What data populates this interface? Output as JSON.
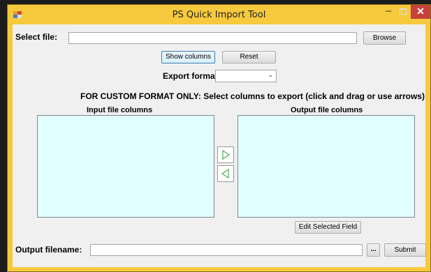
{
  "window": {
    "title": "PS Quick Import Tool"
  },
  "controls": {
    "minimize": "–",
    "close": "✕"
  },
  "select_file": {
    "label": "Select file:",
    "value": "",
    "browse_label": "Browse"
  },
  "show_columns_label": "Show columns",
  "reset_label": "Reset",
  "export_format": {
    "label": "Export format:",
    "selected": ""
  },
  "custom_note": "FOR CUSTOM FORMAT ONLY: Select columns to export (click and drag or use arrows)",
  "input_columns": {
    "label": "Input file columns",
    "items": []
  },
  "output_columns": {
    "label": "Output file columns",
    "items": []
  },
  "edit_field_label": "Edit Selected Field",
  "output_filename": {
    "label": "Output filename:",
    "value": "",
    "ellipsis_label": "...",
    "submit_label": "Submit"
  },
  "colors": {
    "title_bar": "#f7ca3e",
    "listbox_bg": "#e1ffff",
    "close_bg": "#c7413c",
    "arrow_green": "#4caf50"
  }
}
